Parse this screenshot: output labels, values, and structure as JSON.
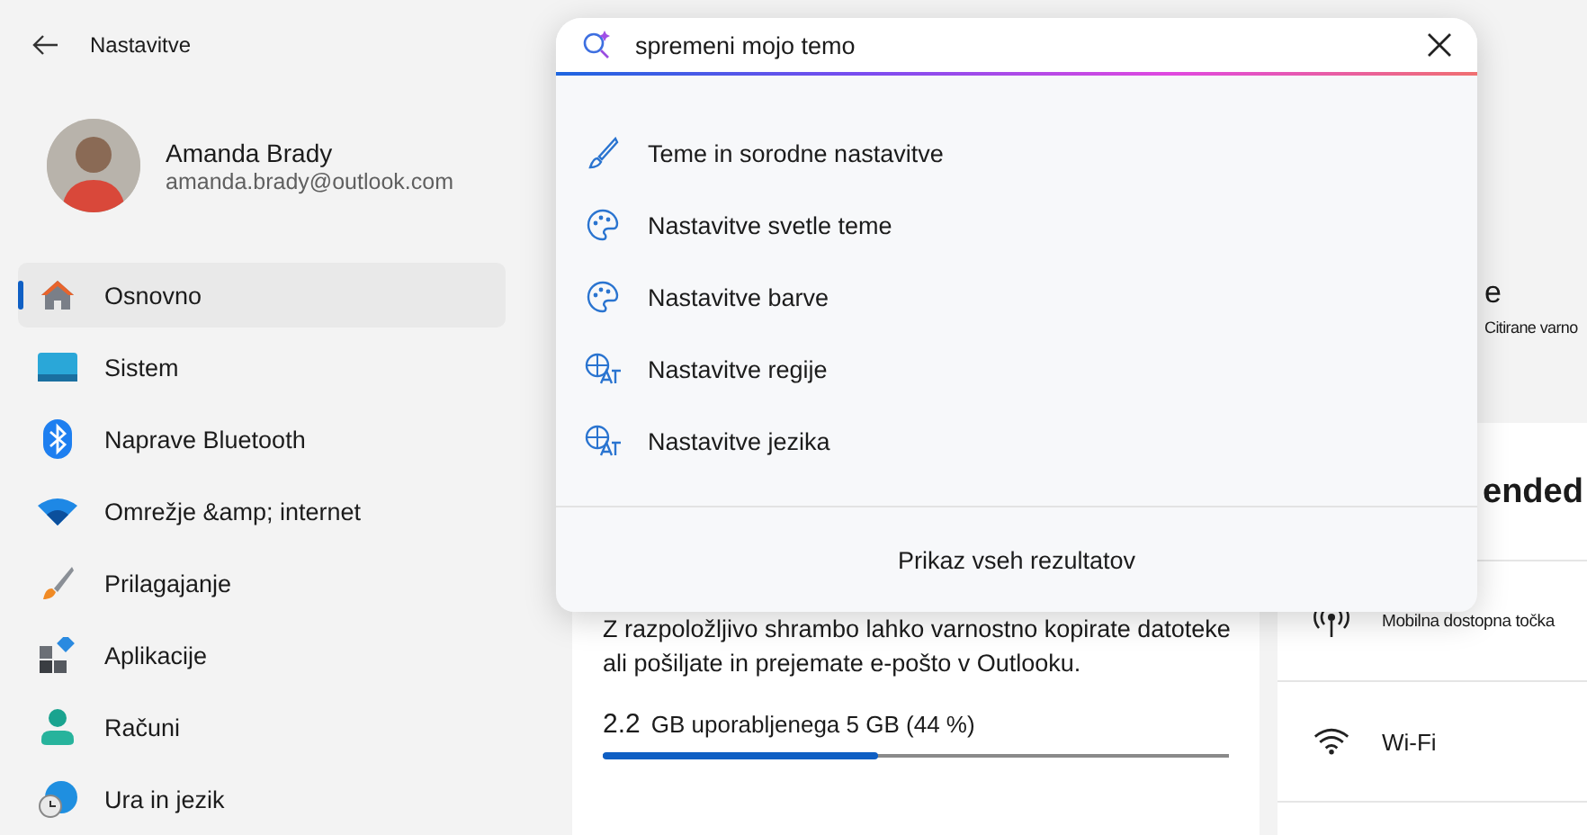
{
  "window": {
    "title": "Nastavitve"
  },
  "account": {
    "name": "Amanda Brady",
    "email": "amanda.brady@outlook.com"
  },
  "sidebar": {
    "items": [
      {
        "label": "Osnovno",
        "kind": "home",
        "selected": true
      },
      {
        "label": "Sistem",
        "kind": "system",
        "selected": false
      },
      {
        "label": "Naprave Bluetooth",
        "kind": "bluetooth",
        "selected": false
      },
      {
        "label": "Omrežje &amp; internet",
        "kind": "network",
        "selected": false
      },
      {
        "label": "Prilagajanje",
        "kind": "brush",
        "selected": false
      },
      {
        "label": "Aplikacije",
        "kind": "apps",
        "selected": false
      },
      {
        "label": "Računi",
        "kind": "person",
        "selected": false
      },
      {
        "label": "Ura in jezik",
        "kind": "globe",
        "selected": false
      }
    ]
  },
  "search": {
    "value": "spremeni mojo temo",
    "results": [
      {
        "label": "Teme in sorodne nastavitve",
        "kind": "brush"
      },
      {
        "label": "Nastavitve svetle teme",
        "kind": "palette"
      },
      {
        "label": "Nastavitve barve",
        "kind": "palette"
      },
      {
        "label": "Nastavitve regije",
        "kind": "language"
      },
      {
        "label": "Nastavitve jezika",
        "kind": "language"
      }
    ],
    "footer": "Prikaz vseh rezultatov"
  },
  "main": {
    "top_panel": {
      "title": "e",
      "caption": "Citirane varno"
    },
    "storage": {
      "description": "Z razpoložljivo shrambo lahko varnostno kopirate datoteke ali pošiljate in prejemate e-pošto v Outlooku.",
      "used": "2.2",
      "detail": "GB uporabljenega 5 GB (44 %)",
      "level": 0.44
    },
    "recommended": {
      "title": "ended",
      "items": [
        {
          "label": "Mobilna dostopna točka",
          "kind": "hotspot"
        },
        {
          "label": "Wi-Fi",
          "kind": "wifi"
        }
      ]
    }
  }
}
